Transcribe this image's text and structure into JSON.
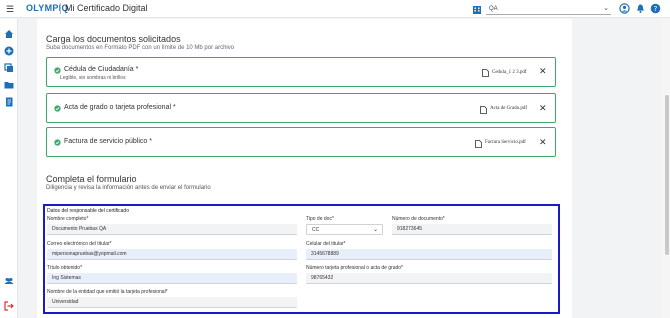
{
  "header": {
    "brand": "OLYMPIQ",
    "app_title": "Mi Certificado Digital",
    "env_select": "QA"
  },
  "section_docs": {
    "title": "Carga los documentos solicitados",
    "subtitle": "Suba documentos en Formato PDF con un límite de 10 Mb por archivo",
    "documents": [
      {
        "name": "Cédula de Ciudadanía *",
        "hint": "Legible, sin sombras ni brillos",
        "file": "Cedula_1 2 3.pdf"
      },
      {
        "name": "Acta de grado o tarjeta profesional *",
        "hint": "",
        "file": "Acta de Grado.pdf"
      },
      {
        "name": "Factura de servicio público *",
        "hint": "",
        "file": "Factura Servicio.pdf"
      }
    ]
  },
  "section_form": {
    "title": "Completa el formulario",
    "subtitle": "Diligencia y revisa la información antes de enviar el formulario",
    "group_title": "Datos del responsable del certificado",
    "fields": {
      "nombre": {
        "label": "Nombre completo*",
        "value": "Documento Pruebas QA"
      },
      "tipo_doc": {
        "label": "Tipo de doc*",
        "value": "CC"
      },
      "num_doc": {
        "label": "Número de documento*",
        "value": "918273645"
      },
      "correo": {
        "label": "Correo electrónico del titular*",
        "value": "mipersonapruebas@yopmail.com"
      },
      "celular": {
        "label": "Celular del titular*",
        "value": "3145678889"
      },
      "titulo": {
        "label": "Título obtenido*",
        "value": "Ing Sistemas"
      },
      "tarjeta": {
        "label": "Número tarjeta profesional o acta de grado*",
        "value": "98765432"
      },
      "entidad": {
        "label": "Nombre de la entidad que emitió la tarjeta profesional*",
        "value": "Universidad"
      }
    }
  },
  "colors": {
    "brand": "#1d6fb8",
    "success_border": "#3ea86a",
    "form_outline": "#1a1acc",
    "sidebar_icon": "#1d6fb8",
    "logout_icon": "#d9342b"
  }
}
